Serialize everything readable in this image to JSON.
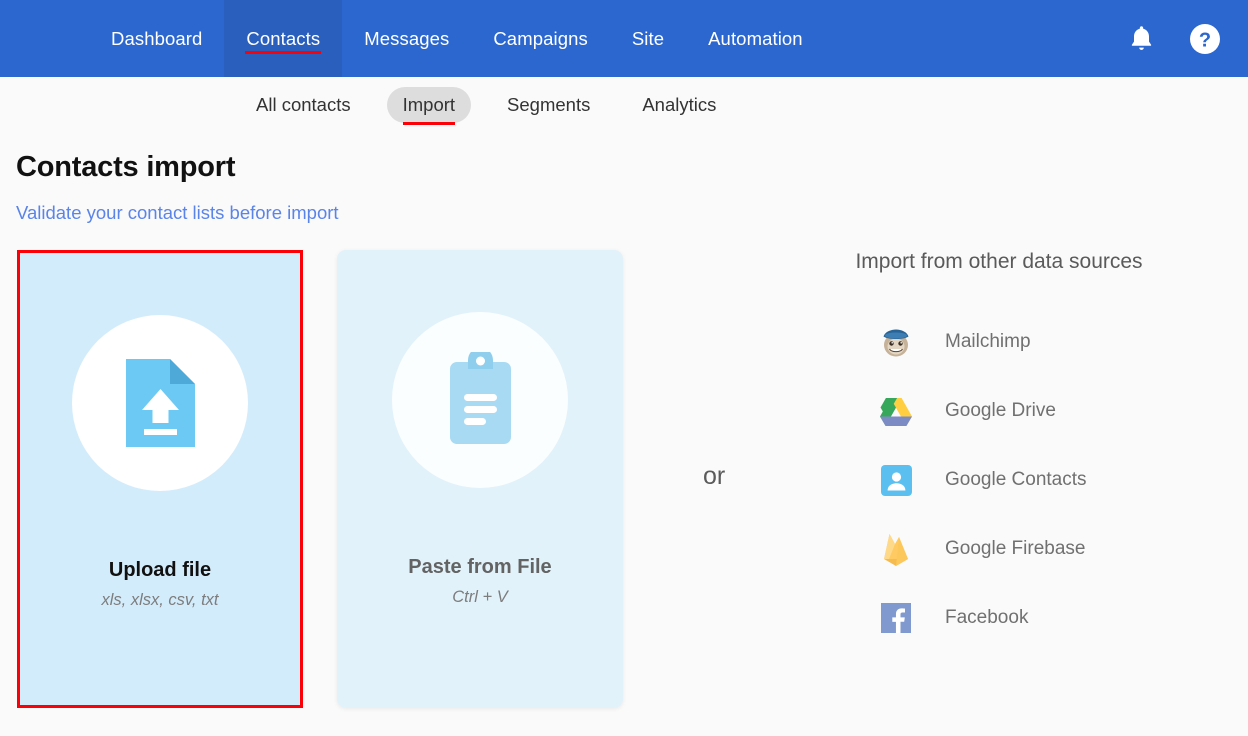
{
  "topnav": {
    "background": "#2b67ce",
    "active_background": "#2a5fbe",
    "annotation_color": "#fb0007",
    "items": [
      {
        "label": "Dashboard",
        "active": false
      },
      {
        "label": "Contacts",
        "active": true
      },
      {
        "label": "Messages",
        "active": false
      },
      {
        "label": "Campaigns",
        "active": false
      },
      {
        "label": "Site",
        "active": false
      },
      {
        "label": "Automation",
        "active": false
      }
    ],
    "actions": [
      {
        "name": "notifications-icon",
        "label": "Notifications"
      },
      {
        "name": "help-icon",
        "label": "Help"
      }
    ]
  },
  "subnav": {
    "items": [
      {
        "label": "All contacts",
        "active": false
      },
      {
        "label": "Import",
        "active": true
      },
      {
        "label": "Segments",
        "active": false
      },
      {
        "label": "Analytics",
        "active": false
      }
    ]
  },
  "header": {
    "title": "Contacts import",
    "link": "Validate your contact lists before import",
    "link_color": "#5a84e8"
  },
  "cards": {
    "upload": {
      "title": "Upload file",
      "subtitle": "xls, xlsx, csv, txt",
      "icon": "file-upload-icon",
      "background": "#d3ecfb",
      "highlighted": true
    },
    "paste": {
      "title": "Paste from File",
      "subtitle": "Ctrl + V",
      "icon": "clipboard-icon",
      "background": "#e2f2fa",
      "highlighted": false
    }
  },
  "divider": {
    "label": "or"
  },
  "sources": {
    "title": "Import from other data sources",
    "items": [
      {
        "label": "Mailchimp",
        "icon": "mailchimp-icon"
      },
      {
        "label": "Google Drive",
        "icon": "google-drive-icon"
      },
      {
        "label": "Google Contacts",
        "icon": "google-contacts-icon"
      },
      {
        "label": "Google Firebase",
        "icon": "google-firebase-icon"
      },
      {
        "label": "Facebook",
        "icon": "facebook-icon"
      }
    ]
  }
}
